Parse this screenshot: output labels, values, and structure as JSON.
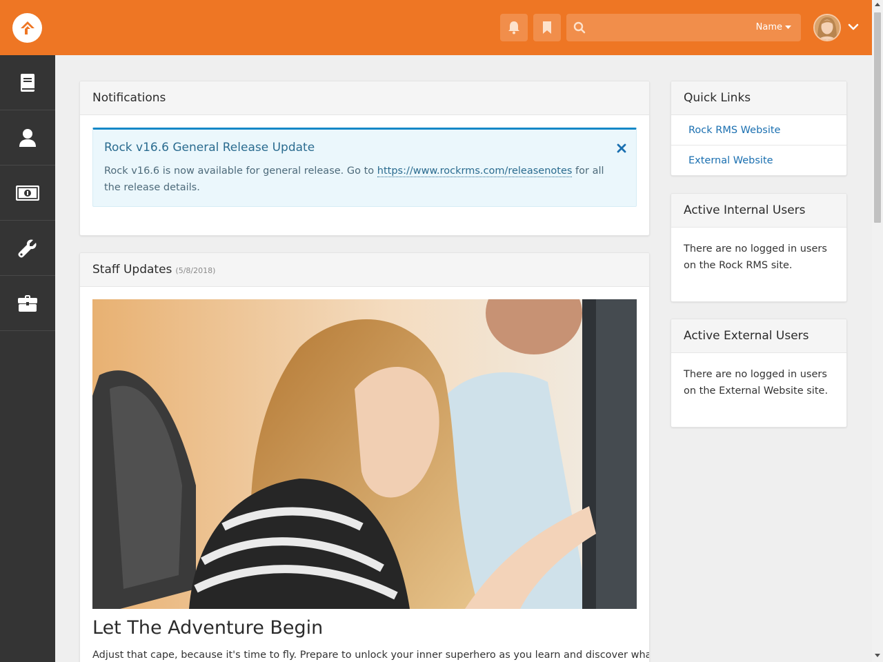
{
  "header": {
    "search": {
      "value": "",
      "filter_label": "Name"
    }
  },
  "notifications": {
    "title": "Notifications",
    "alert": {
      "title": "Rock v16.6 General Release Update",
      "body_before": "Rock v16.6 is now available for general release. Go to ",
      "link": "https://www.rockrms.com/releasenotes",
      "body_after": " for all the release details."
    }
  },
  "staff_updates": {
    "title": "Staff Updates",
    "date": "(5/8/2018)",
    "article_title": "Let The Adventure Begin",
    "article_text": "Adjust that cape, because it's time to fly. Prepare to unlock your inner superhero as you learn and discover what"
  },
  "quick_links": {
    "title": "Quick Links",
    "items": [
      {
        "label": "Rock RMS Website"
      },
      {
        "label": "External Website"
      }
    ]
  },
  "active_internal_users": {
    "title": "Active Internal Users",
    "text": "There are no logged in users on the Rock RMS site."
  },
  "active_external_users": {
    "title": "Active External Users",
    "text": "There are no logged in users on the External Website site."
  },
  "colors": {
    "brand": "#ee7624",
    "sidebar": "#343434",
    "link": "#1a6fb0",
    "alert_border": "#1488c7",
    "alert_bg": "#ebf7fc"
  },
  "icons": {
    "logo": "rock-logo-icon",
    "notifications": "bell-icon",
    "bookmarks": "bookmark-icon",
    "search": "search-icon",
    "nav": [
      "book-icon",
      "user-icon",
      "money-icon",
      "wrench-icon",
      "briefcase-icon"
    ]
  }
}
